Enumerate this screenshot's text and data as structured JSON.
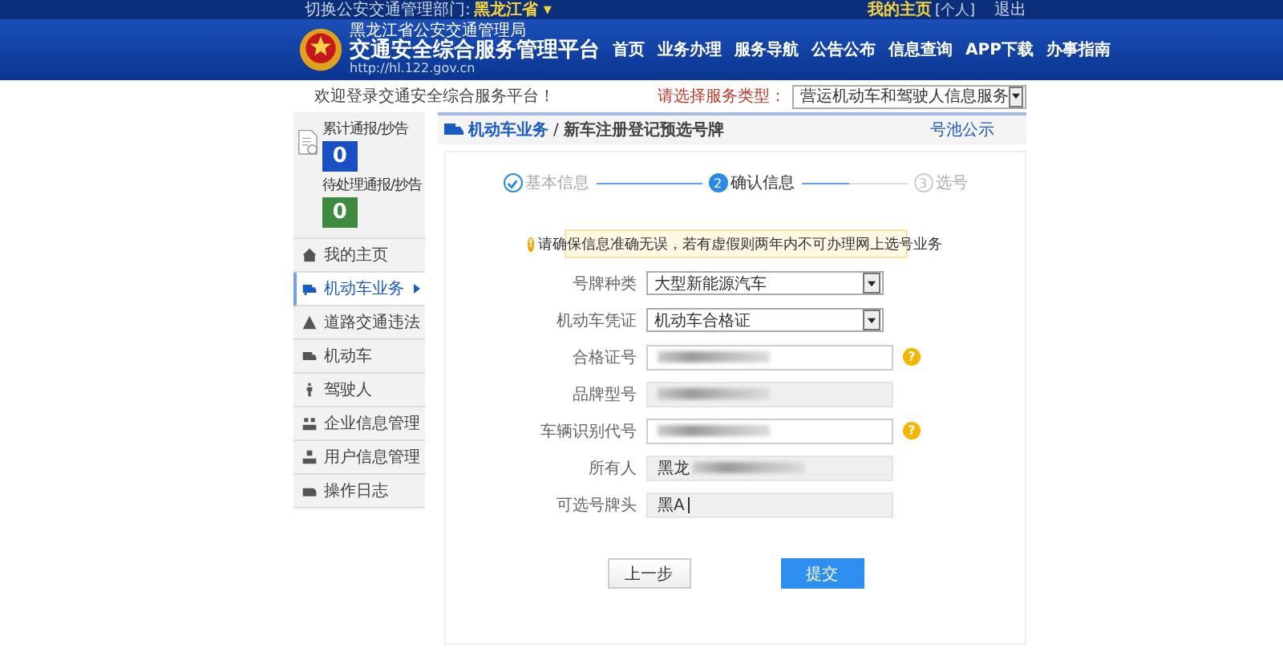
{
  "top_bar": {
    "switch_label": "切换公安交通管理部门:",
    "region": "黑龙江省",
    "region_caret": "▾",
    "user_link": "我的主页",
    "user_tag": "[个人]",
    "logout": "退出"
  },
  "header": {
    "org": "黑龙江省公安交通管理局",
    "title": "交通安全综合服务管理平台",
    "url": "http://hl.122.gov.cn",
    "nav": [
      "首页",
      "业务办理",
      "服务导航",
      "公告公布",
      "信息查询",
      "APP下载",
      "办事指南"
    ]
  },
  "welcome": "欢迎登录交通安全综合服务平台！",
  "service": {
    "label": "请选择服务类型：",
    "value": "营运机动车和驾驶人信息服务"
  },
  "stats": [
    {
      "label": "累计通报/抄告",
      "count": "0",
      "color": "#1a4fc4"
    },
    {
      "label": "待处理通报/抄告",
      "count": "0",
      "color": "#3e8a3e"
    }
  ],
  "sidebar": {
    "items": [
      {
        "label": "我的主页",
        "selected": false
      },
      {
        "label": "机动车业务",
        "selected": true
      },
      {
        "label": "道路交通违法",
        "selected": false
      },
      {
        "label": "机动车",
        "selected": false
      },
      {
        "label": "驾驶人",
        "selected": false
      },
      {
        "label": "企业信息管理",
        "selected": false
      },
      {
        "label": "用户信息管理",
        "selected": false
      },
      {
        "label": "操作日志",
        "selected": false
      }
    ]
  },
  "breadcrumb": {
    "section": "机动车业务",
    "separator": "/",
    "page": "新车注册登记预选号牌",
    "link": "号池公示"
  },
  "steps": [
    {
      "label": "基本信息",
      "completed": true,
      "selected": false
    },
    {
      "marker": "2",
      "label": "确认信息",
      "completed": false,
      "selected": true
    },
    {
      "marker": "3",
      "label": "选号",
      "completed": false,
      "selected": false
    }
  ],
  "notice": {
    "icon": "!",
    "text": "请确保信息准确无误，若有虚假则两年内不可办理网上选号业务"
  },
  "form": [
    {
      "kind": "select",
      "label": "号牌种类",
      "value": "大型新能源汽车"
    },
    {
      "kind": "select",
      "label": "机动车凭证",
      "value": "机动车合格证"
    },
    {
      "kind": "input",
      "label": "合格证号",
      "redacted": true,
      "help": "?"
    },
    {
      "kind": "readonly",
      "label": "品牌型号",
      "redacted": true
    },
    {
      "kind": "input",
      "label": "车辆识别代号",
      "redacted": true,
      "help": "?"
    },
    {
      "kind": "readonly",
      "label": "所有人",
      "value": "黑龙",
      "redacted": true
    },
    {
      "kind": "readonly",
      "label": "可选号牌头",
      "value": "黑A",
      "redacted": false
    }
  ],
  "buttons": [
    {
      "label": "上一步",
      "kind": "secondary"
    },
    {
      "label": "提交",
      "kind": "primary"
    }
  ]
}
